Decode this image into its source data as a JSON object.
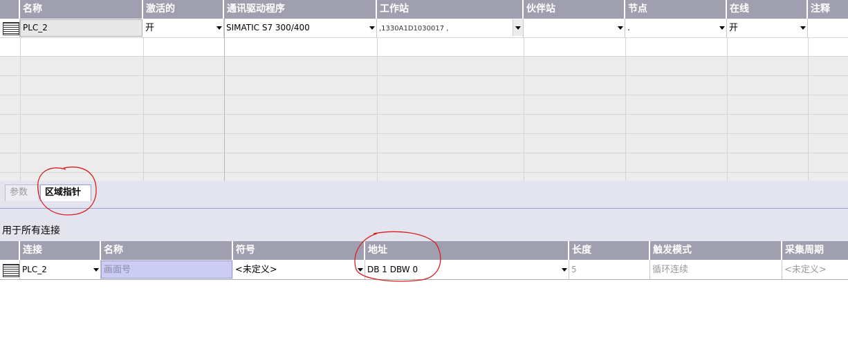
{
  "connections_table": {
    "columns": [
      "名称",
      "激活的",
      "通讯驱动程序",
      "工作站",
      "伙伴站",
      "节点",
      "在线",
      "注释"
    ],
    "row": {
      "name": "PLC_2",
      "active": "开",
      "driver": "SIMATIC S7 300/400",
      "station": ",1330A1D1030017 ,",
      "partner": "",
      "node": ".",
      "online": "开",
      "comment": ""
    }
  },
  "tabs": [
    {
      "label": "参数",
      "active": false
    },
    {
      "label": "区域指针",
      "active": true
    }
  ],
  "section_title": "用于所有连接",
  "area_pointer_table": {
    "columns": [
      "连接",
      "名称",
      "符号",
      "地址",
      "长度",
      "触发模式",
      "采集周期"
    ],
    "row": {
      "connection": "PLC_2",
      "name": "画面号",
      "symbol": "<未定义>",
      "address": "DB 1 DBW 0",
      "length": "5",
      "trigger_mode": "循环连续",
      "acquisition_cycle": "<未定义>"
    }
  },
  "colors": {
    "header_bg": "#9f9faf",
    "annotation_red": "#d81c1c",
    "panel_bg": "#e4e4ee",
    "name_cell_highlight": "#ccccf4"
  }
}
